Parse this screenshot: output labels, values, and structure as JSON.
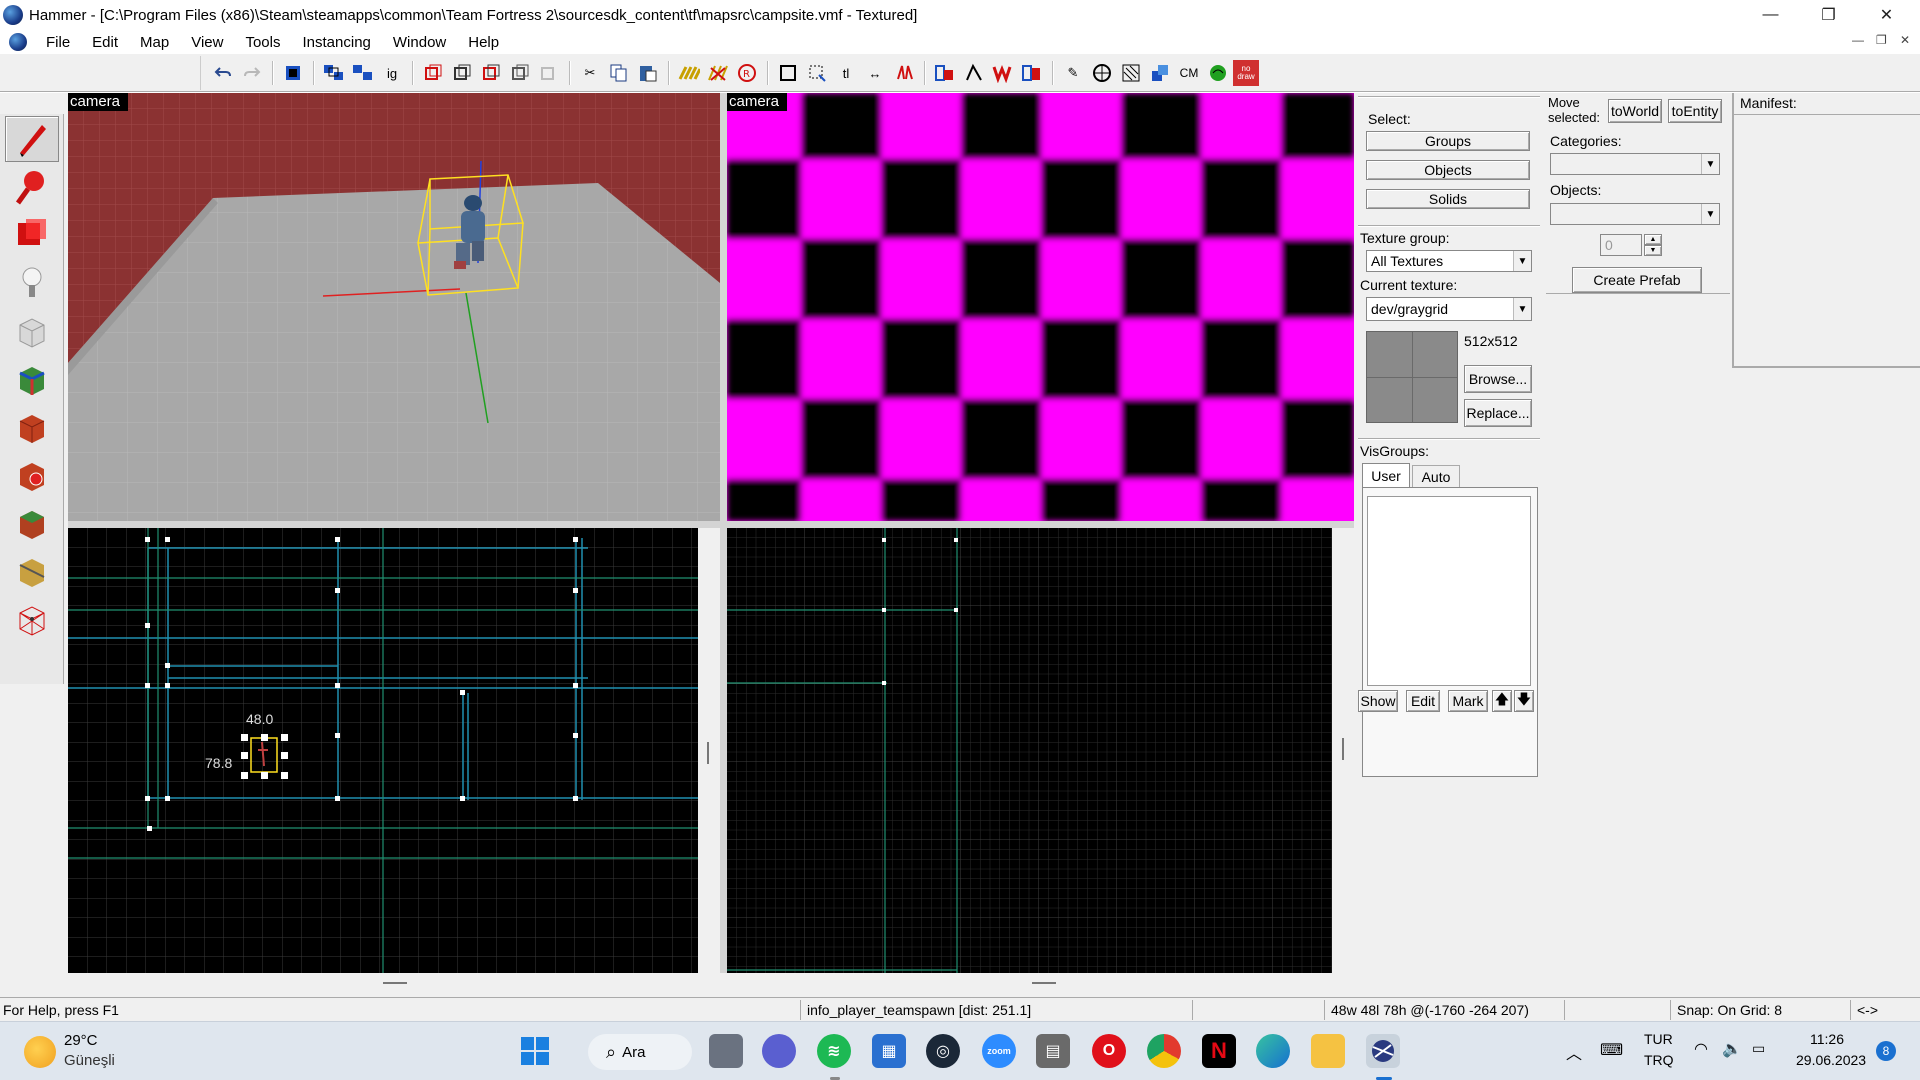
{
  "window": {
    "title": "Hammer - [C:\\Program Files (x86)\\Steam\\steamapps\\common\\Team Fortress 2\\sourcesdk_content\\tf\\mapsrc\\campsite.vmf - Textured]",
    "minimize": "—",
    "restore": "❐",
    "close": "✕"
  },
  "menu": [
    "File",
    "Edit",
    "Map",
    "View",
    "Tools",
    "Instancing",
    "Window",
    "Help"
  ],
  "mdi_controls": [
    "—",
    "❐",
    "✕"
  ],
  "toolbar": {
    "ig_label": "ig",
    "tl_label": "tl",
    "cm_label": "CM",
    "nodraw_label": "no draw"
  },
  "viewports": {
    "camera3d_label": "camera",
    "texture_label": "camera",
    "top_width_dim": "48.0",
    "top_height_dim": "78.8"
  },
  "panel": {
    "select_label": "Select:",
    "groups_btn": "Groups",
    "objects_btn": "Objects",
    "solids_btn": "Solids",
    "texture_group_label": "Texture group:",
    "texture_group_value": "All Textures",
    "current_texture_label": "Current texture:",
    "current_texture_value": "dev/graygrid",
    "texture_size": "512x512",
    "browse_btn": "Browse...",
    "replace_btn": "Replace...",
    "visgroups_label": "VisGroups:",
    "tab_user": "User",
    "tab_auto": "Auto",
    "show_btn": "Show",
    "edit_btn": "Edit",
    "mark_btn": "Mark",
    "up_btn": "🡅",
    "down_btn": "🡇",
    "move_selected_label": "Move selected:",
    "toworld_btn": "toWorld",
    "toentity_btn": "toEntity",
    "categories_label": "Categories:",
    "objects_label": "Objects:",
    "spin_value": "0",
    "create_prefab_btn": "Create Prefab",
    "manifest_label": "Manifest:"
  },
  "statusbar": {
    "help": "For Help, press F1",
    "selection": "info_player_teamspawn    [dist: 251.1]",
    "dims": "48w 48l 78h @(-1760 -264 207)",
    "snap": "Snap: On Grid: 8",
    "arrows": "<->"
  },
  "taskbar": {
    "temperature": "29°C",
    "weather": "Güneşli",
    "search": "Ara",
    "lang1": "TUR",
    "lang2": "TRQ",
    "time": "11:26",
    "date": "29.06.2023",
    "notifications": "8",
    "netflix_letter": "N",
    "zoom_label": "zoom"
  },
  "colors": {
    "wall": "#8b3232",
    "floor": "#a9a9a9",
    "checker_a": "#ff00ff",
    "checker_b": "#000000",
    "grid": "#2a2a2a",
    "brush_cyan": "#30c0d0",
    "brush_teal": "#20a080"
  }
}
